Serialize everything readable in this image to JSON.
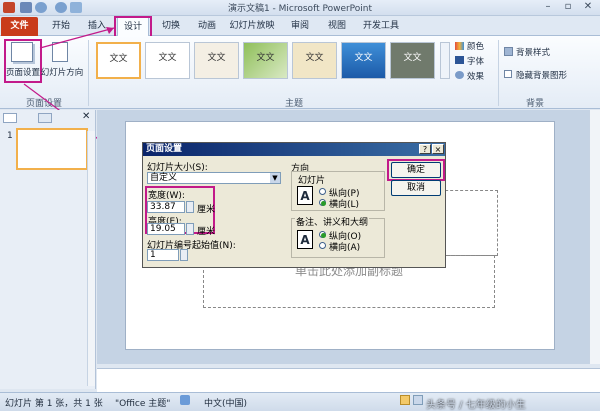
{
  "window": {
    "title": "演示文稿1 - Microsoft PowerPoint",
    "controls": {
      "min": "–",
      "max": "▫",
      "close": "✕"
    }
  },
  "tabs": [
    "文件",
    "开始",
    "插入",
    "设计",
    "切换",
    "动画",
    "幻灯片放映",
    "审阅",
    "视图",
    "开发工具"
  ],
  "ribbon": {
    "page_setup_group": {
      "group_label": "页面设置",
      "page_setup_button": "页面设置",
      "orientation_button": "幻灯片方向"
    },
    "themes_group": {
      "group_label": "主题",
      "theme_label": "文文",
      "colors": "颜色",
      "fonts": "字体",
      "effects": "效果"
    },
    "background_group": {
      "group_label": "背景",
      "bg_styles": "背景样式",
      "hide_bg": "隐藏背景图形"
    }
  },
  "slides_pane": {
    "slide_number": "1"
  },
  "slide": {
    "placeholder_text": "单击此处添加副标题"
  },
  "dialog": {
    "title": "页面设置",
    "size_label": "幻灯片大小(S):",
    "size_value": "自定义",
    "width_label": "宽度(W):",
    "width_value": "33.87",
    "width_unit": "厘米",
    "height_label": "高度(E):",
    "height_value": "19.05",
    "height_unit": "厘米",
    "numbering_label": "幻灯片编号起始值(N):",
    "numbering_value": "1",
    "orientation_label": "方向",
    "slides_label": "幻灯片",
    "notes_label": "备注、讲义和大纲",
    "portrait_1": "纵向(P)",
    "landscape_1": "横向(L)",
    "portrait_2": "纵向(O)",
    "landscape_2": "横向(A)",
    "ok_button": "确定",
    "cancel_button": "取消",
    "help_button": "?",
    "close_button": "×"
  },
  "status": {
    "slide_info": "幻灯片 第 1 张，共 1 张",
    "theme": "\"Office 主题\"",
    "language": "中文(中国)",
    "watermark": "头条号 / 七年级的小生"
  },
  "colors": {
    "highlight": "#c21a8a",
    "file_tab": "#c93b1a"
  }
}
